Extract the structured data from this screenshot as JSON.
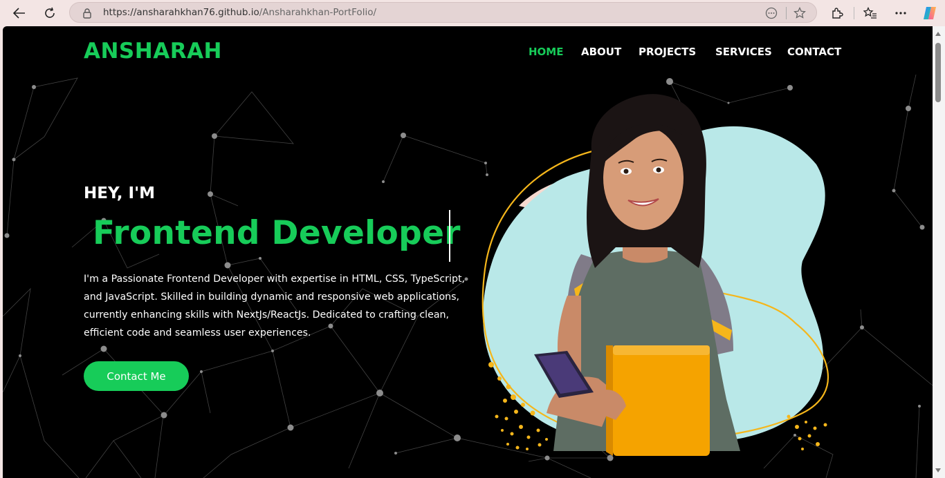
{
  "browser": {
    "url_host": "https://ansharahkhan76.github.io",
    "url_path": "/Ansharahkhan-PortFolio/",
    "icons": [
      "back-icon",
      "reload-icon",
      "lock-icon",
      "reader-icon",
      "favorite-star-icon",
      "extensions-icon",
      "favorites-icon",
      "more-icon",
      "copilot-icon"
    ]
  },
  "header": {
    "logo": "ANSHARAH",
    "nav": [
      "HOME",
      "ABOUT",
      "PROJECTS",
      "SERVICES",
      "CONTACT"
    ],
    "active_nav": "HOME"
  },
  "hero": {
    "greeting": "HEY, I'M",
    "role": "Frontend Developer",
    "description": "I'm a Passionate Frontend Developer with expertise in HTML, CSS, TypeScript, and JavaScript. Skilled in building dynamic and responsive web applications, currently enhancing skills with NextJs/ReactJs. Dedicated to crafting clean, efficient code and seamless user experiences.",
    "cta": "Contact Me"
  },
  "colors": {
    "accent": "#17cc59",
    "background": "#000000",
    "blob": "#b9e8e8",
    "ring": "#f5b61b"
  }
}
